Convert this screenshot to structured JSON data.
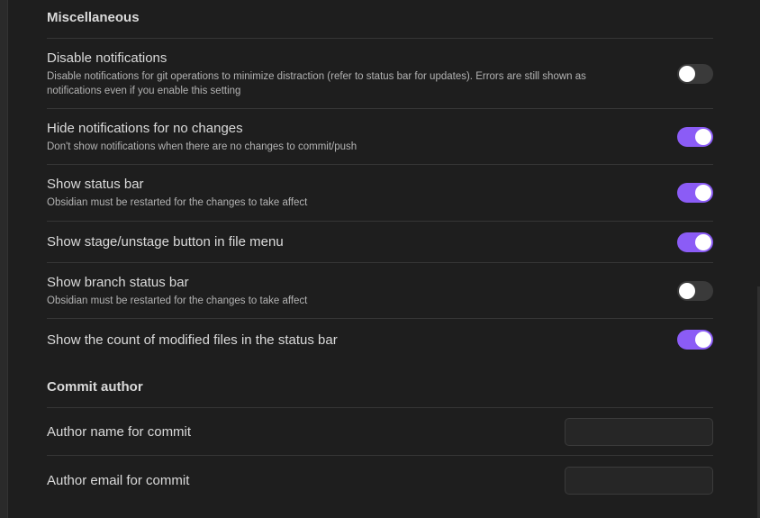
{
  "sections": {
    "misc_heading": "Miscellaneous",
    "commit_author_heading": "Commit author"
  },
  "settings": [
    {
      "name": "Disable notifications",
      "desc": "Disable notifications for git operations to minimize distraction (refer to status bar for updates). Errors are still shown as notifications even if you enable this setting",
      "enabled": false
    },
    {
      "name": "Hide notifications for no changes",
      "desc": "Don't show notifications when there are no changes to commit/push",
      "enabled": true
    },
    {
      "name": "Show status bar",
      "desc": "Obsidian must be restarted for the changes to take affect",
      "enabled": true
    },
    {
      "name": "Show stage/unstage button in file menu",
      "desc": "",
      "enabled": true
    },
    {
      "name": "Show branch status bar",
      "desc": "Obsidian must be restarted for the changes to take affect",
      "enabled": false
    },
    {
      "name": "Show the count of modified files in the status bar",
      "desc": "",
      "enabled": true
    }
  ],
  "author": {
    "name_label": "Author name for commit",
    "name_value": "",
    "email_label": "Author email for commit",
    "email_value": ""
  },
  "colors": {
    "background": "#1e1e1e",
    "accent": "#8b5cf6",
    "toggle_off": "#3a3a3a"
  }
}
